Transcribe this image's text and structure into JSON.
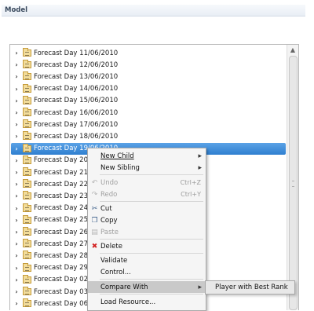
{
  "header": {
    "title": "Model"
  },
  "tree": {
    "selected_index": 8,
    "items": [
      "Forecast Day 11/06/2010",
      "Forecast Day 12/06/2010",
      "Forecast Day 13/06/2010",
      "Forecast Day 14/06/2010",
      "Forecast Day 15/06/2010",
      "Forecast Day 16/06/2010",
      "Forecast Day 17/06/2010",
      "Forecast Day 18/06/2010",
      "Forecast Day 19/06/2010",
      "Forecast Day 20/06",
      "Forecast Day 21/06",
      "Forecast Day 22/06",
      "Forecast Day 23/06",
      "Forecast Day 24/06",
      "Forecast Day 25/06",
      "Forecast Day 26/06",
      "Forecast Day 27/06",
      "Forecast Day 28/06",
      "Forecast Day 29/06",
      "Forecast Day 02/07",
      "Forecast Day 03/07",
      "Forecast Day 06/07"
    ]
  },
  "context_menu": {
    "new_child": "New Child",
    "new_sibling": "New Sibling",
    "undo": "Undo",
    "undo_shortcut": "Ctrl+Z",
    "redo": "Redo",
    "redo_shortcut": "Ctrl+Y",
    "cut": "Cut",
    "copy": "Copy",
    "paste": "Paste",
    "delete": "Delete",
    "validate": "Validate",
    "control": "Control...",
    "compare_with": "Compare With",
    "load_resource": "Load Resource..."
  },
  "submenu": {
    "item": "Player with Best Rank"
  },
  "colors": {
    "selection": "#3a8ad8",
    "menu_bg": "#f5f5f5",
    "hover": "#c9c9c9"
  }
}
